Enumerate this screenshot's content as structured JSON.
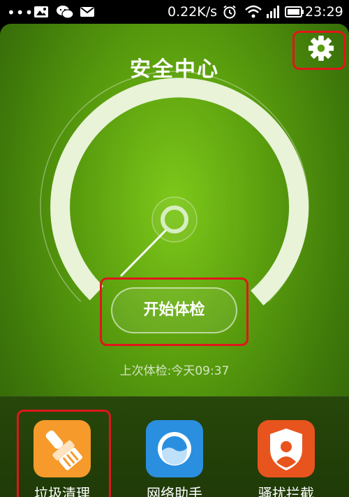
{
  "status_bar": {
    "dots": "•••",
    "speed": "0.22K/s",
    "time": "23:29",
    "icons": [
      "gallery-icon",
      "wechat-icon",
      "mail-icon",
      "alarm-icon",
      "wifi-icon",
      "signal-icon",
      "battery-icon"
    ]
  },
  "header": {
    "title": "安全中心"
  },
  "gauge": {
    "button_label": "开始体检"
  },
  "last_check": "上次体检:今天09:37",
  "tools": [
    {
      "label": "垃圾清理",
      "icon": "broom-icon",
      "color": "#f59a2b"
    },
    {
      "label": "网络助手",
      "icon": "network-icon",
      "color": "#2b8fe0"
    },
    {
      "label": "骚扰拦截",
      "icon": "shield-user-icon",
      "color": "#e8541d"
    }
  ],
  "colors": {
    "highlight": "#e0161b",
    "accent": "#7ec81a"
  }
}
